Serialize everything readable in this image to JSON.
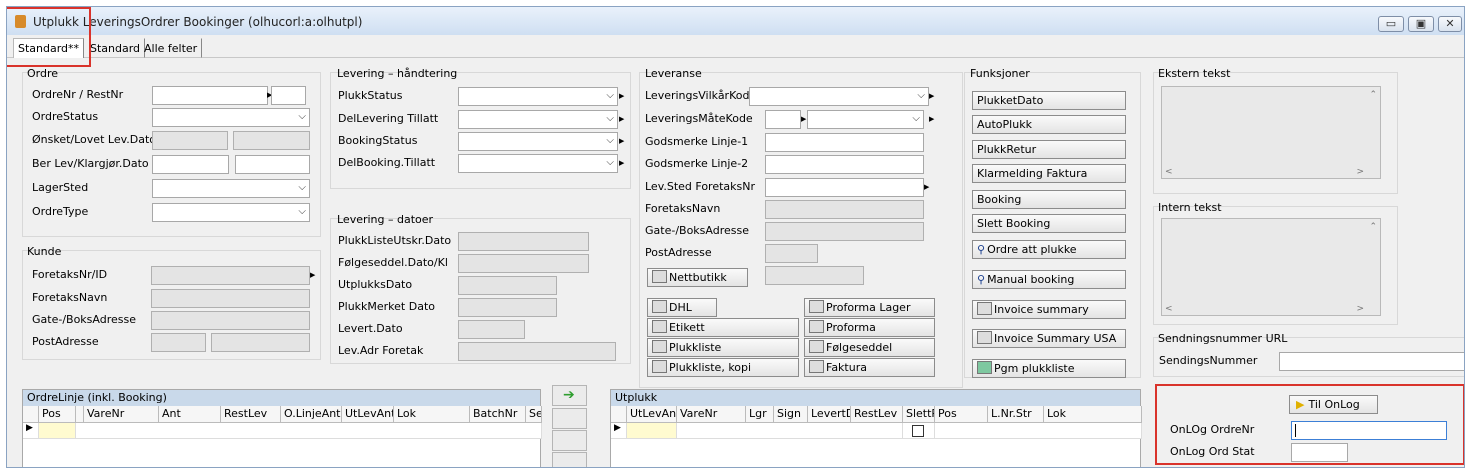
{
  "window": {
    "title": "Utplukk LeveringsOrdrer Bookinger (olhucorl:a:olhutpl)",
    "btn_min": "▭",
    "btn_max": "▣",
    "btn_close": "✕"
  },
  "tabs": [
    "Standard**",
    "Standard",
    "Alle felter"
  ],
  "ordre": {
    "title": "Ordre",
    "labels": [
      "OrdreNr / RestNr",
      "OrdreStatus",
      "Ønsket/Lovet Lev.Dato",
      "Ber Lev/Klargjør.Dato",
      "LagerSted",
      "OrdreType"
    ]
  },
  "kunde": {
    "title": "Kunde",
    "labels": [
      "ForetaksNr/ID",
      "ForetaksNavn",
      "Gate-/BoksAdresse",
      "PostAdresse"
    ]
  },
  "lev_handtering": {
    "title": "Levering – håndtering",
    "labels": [
      "PlukkStatus",
      "DelLevering Tillatt",
      "BookingStatus",
      "DelBooking.Tillatt"
    ]
  },
  "lev_datoer": {
    "title": "Levering – datoer",
    "labels": [
      "PlukkListeUtskr.Dato",
      "Følgeseddel.Dato/Kl",
      "UtplukksDato",
      "PlukkMerket Dato",
      "Levert.Dato",
      "Lev.Adr Foretak"
    ]
  },
  "leveranse": {
    "title": "Leveranse",
    "labels": [
      "LeveringsVilkårKode",
      "LeveringsMåteKode",
      "Godsmerke Linje-1",
      "Godsmerke Linje-2",
      "Lev.Sted ForetaksNr",
      "ForetaksNavn",
      "Gate-/BoksAdresse",
      "PostAdresse"
    ],
    "nettbutikk": "Nettbutikk",
    "left_buttons": [
      "DHL",
      "Etikett",
      "Plukkliste",
      "Plukkliste, kopi"
    ],
    "right_buttons": [
      "Proforma Lager",
      "Proforma",
      "Følgeseddel",
      "Faktura"
    ]
  },
  "funksjoner": {
    "title": "Funksjoner",
    "buttons": [
      "PlukketDato",
      "AutoPlukk",
      "PlukkRetur",
      "Klarmelding Faktura",
      "Booking",
      "Slett Booking",
      "Ordre att plukke",
      "Manual booking",
      "Invoice summary",
      "Invoice Summary USA",
      "Pgm plukkliste"
    ]
  },
  "ekstern": {
    "title": "Ekstern tekst"
  },
  "intern": {
    "title": "Intern tekst"
  },
  "sendnr": {
    "title": "Sendningsnummer URL",
    "label": "SendingsNummer"
  },
  "ordrelinje": {
    "title": "OrdreLinje (inkl. Booking)",
    "columns": [
      "Pos",
      "VareNr",
      "Ant",
      "RestLev",
      "O.LinjeAnt",
      "UtLevAnt",
      "Lok",
      "BatchNr",
      "Se"
    ]
  },
  "utplukk": {
    "title": "Utplukk",
    "columns": [
      "UtLevAnt",
      "VareNr",
      "Lgr",
      "Sign",
      "LevertD",
      "RestLev",
      "SlettR",
      "Pos",
      "L.Nr.Str",
      "Lok"
    ]
  },
  "onlog": {
    "button": "Til OnLog",
    "ordrenr_label": "OnLOg OrdreNr",
    "ordstat_label": "OnLog Ord Stat"
  },
  "colors": {
    "highlight_red": "#d9332b",
    "grid_header": "#c9d9ea",
    "row_yellow": "#fffbd0"
  }
}
